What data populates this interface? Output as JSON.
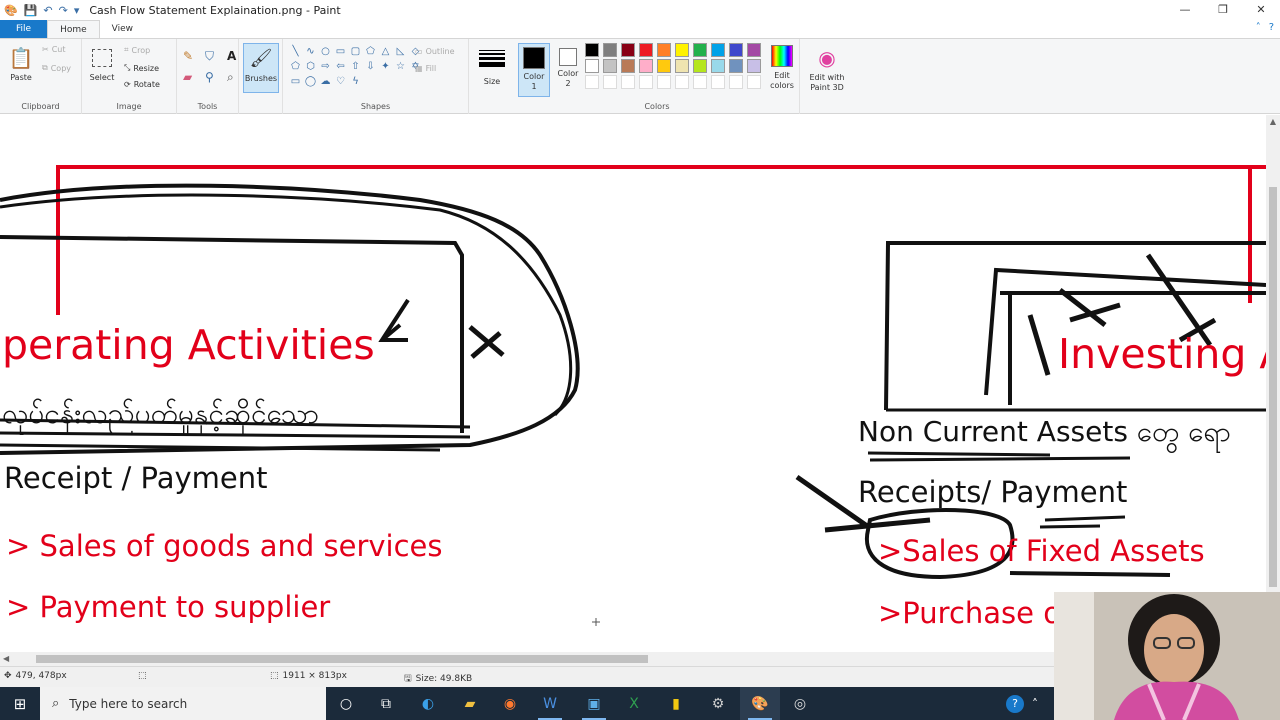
{
  "window": {
    "title": "Cash Flow Statement Explaination.png - Paint"
  },
  "tabs": [
    {
      "label": "File"
    },
    {
      "label": "Home"
    },
    {
      "label": "View"
    }
  ],
  "ribbon": {
    "clipboard": {
      "paste": "Paste",
      "cut": "Cut",
      "copy": "Copy",
      "group": "Clipboard"
    },
    "image": {
      "select": "Select",
      "crop": "Crop",
      "resize": "Resize",
      "rotate": "Rotate",
      "group": "Image"
    },
    "tools": {
      "group": "Tools"
    },
    "brushes": {
      "label": "Brushes"
    },
    "shapes": {
      "outline": "Outline",
      "fill": "Fill",
      "group": "Shapes"
    },
    "size": {
      "label": "Size"
    },
    "color1": {
      "label": "Color",
      "num": "1"
    },
    "color2": {
      "label": "Color",
      "num": "2"
    },
    "colors": {
      "group": "Colors"
    },
    "edit_colors": {
      "line1": "Edit",
      "line2": "colors"
    },
    "paint3d": {
      "line1": "Edit with",
      "line2": "Paint 3D"
    },
    "palette": [
      "#000000",
      "#7f7f7f",
      "#880015",
      "#ed1c24",
      "#ff7f27",
      "#fff200",
      "#22b14c",
      "#00a2e8",
      "#3f48cc",
      "#a349a4",
      "#ffffff",
      "#c3c3c3",
      "#b97a57",
      "#ffaec9",
      "#ffc90e",
      "#efe4b0",
      "#b5e61d",
      "#99d9ea",
      "#7092be",
      "#c8bfe7"
    ]
  },
  "canvas": {
    "operating_title": "perating Activities",
    "burmese_text": "လုပ်ငန်းလည်ပတ်မှုနှင့်ဆိုင်သော",
    "receipt_payment": "Receipt / Payment",
    "sales_goods": "> Sales of goods and services",
    "payment_supplier": "> Payment to supplier",
    "investing_title": "Investing A",
    "non_current": "Non Current Assets တွေ ရော",
    "receipts_payment": "Receipts/ Payment",
    "sales_fixed": ">Sales of Fixed Assets",
    "purchase": ">Purchase o"
  },
  "status": {
    "cursor_pos": "479, 478px",
    "dimensions": "1911 × 813px",
    "size": "Size: 49.8KB"
  },
  "taskbar": {
    "search_placeholder": "Type here to search"
  },
  "colors": {
    "red_text": "#e2001a",
    "accent": "#1979ca"
  }
}
